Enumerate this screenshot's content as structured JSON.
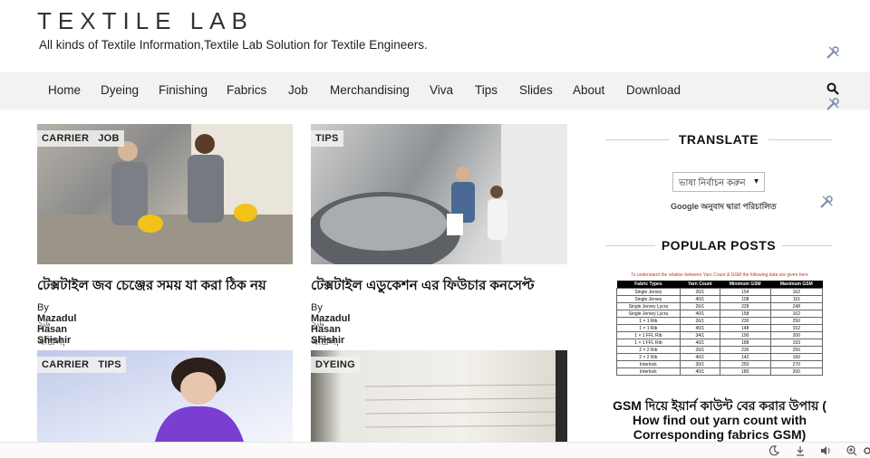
{
  "site": {
    "title": "TEXTILE LAB",
    "tagline": "All kinds of Textile Information,Textile Lab Solution for Textile Engineers."
  },
  "nav": {
    "items": [
      "Home",
      "Dyeing",
      "Finishing",
      "Fabrics",
      "Job",
      "Merchandising",
      "Viva",
      "Tips",
      "Slides",
      "About",
      "Download"
    ]
  },
  "posts": [
    {
      "tags": [
        "CARRIER",
        "JOB"
      ],
      "title": "টেক্সটাইল জব চেঞ্জের সময় যা করা ঠিক নয়",
      "author_prefix": "By",
      "author": "Mazadul Hasan Shishir",
      "date": "২৬ এপ্রিল, ২০১৭"
    },
    {
      "tags": [
        "TIPS"
      ],
      "title": "টেক্সটাইল এডুকেশন এর ফিউচার কনসেপ্ট",
      "author_prefix": "By",
      "author": "Mazadul Hasan Shishir",
      "date": "২৬ এপ্রিল, ২০১৭"
    },
    {
      "tags": [
        "CARRIER",
        "TIPS"
      ]
    },
    {
      "tags": [
        "DYEING"
      ]
    }
  ],
  "sidebar": {
    "translate_heading": "TRANSLATE",
    "language_select": "ভাষা নির্বাচন করুন",
    "google_prefix": "Google",
    "google_suffix": "অনুবাদ দ্বারা পরিচালিত",
    "popular_heading": "POPULAR POSTS",
    "popular_image": {
      "title": "To understand the relation between Yarn Count & GSM the following data are given here",
      "headers": [
        "Fabric Types",
        "Yarn Count",
        "Minimum GSM",
        "Maximum GSM"
      ],
      "rows": [
        [
          "Single Jersey",
          "26/1",
          "154",
          "162"
        ],
        [
          "Single Jersey",
          "40/1",
          "108",
          "115"
        ],
        [
          "Single Jersey Lycra",
          "26/1",
          "228",
          "248"
        ],
        [
          "Single Jersey Lycra",
          "40/1",
          "158",
          "162"
        ],
        [
          "1 × 1 Rib",
          "26/1",
          "230",
          "250"
        ],
        [
          "1 × 1 Rib",
          "40/1",
          "148",
          "152"
        ],
        [
          "1 × 1 FFL Rib",
          "34/1",
          "190",
          "200"
        ],
        [
          "1 × 1 FFL Rib",
          "40/1",
          "188",
          "193"
        ],
        [
          "2 × 2 Rib",
          "26/1",
          "230",
          "250"
        ],
        [
          "2 × 2 Rib",
          "40/1",
          "142",
          "160"
        ],
        [
          "Interlock",
          "30/1",
          "250",
          "270"
        ],
        [
          "Interlock",
          "40/1",
          "180",
          "200"
        ]
      ]
    },
    "popular_post_title": "GSM দিয়ে ইয়ার্ন কাউন্ট বের করার উপায় ( How find out yarn count with Corresponding fabrics GSM)"
  },
  "icons": {
    "tool": "wrench-screwdriver-icon",
    "search": "search-icon",
    "moon": "moon-icon",
    "download": "download-icon",
    "volume": "volume-icon",
    "zoom": "zoom-in-icon",
    "settings": "gear-icon"
  },
  "colors": {
    "nav_bg": "#f2f2f2",
    "badge_bg": "#f0f0f0",
    "table_title": "#c0392b"
  }
}
